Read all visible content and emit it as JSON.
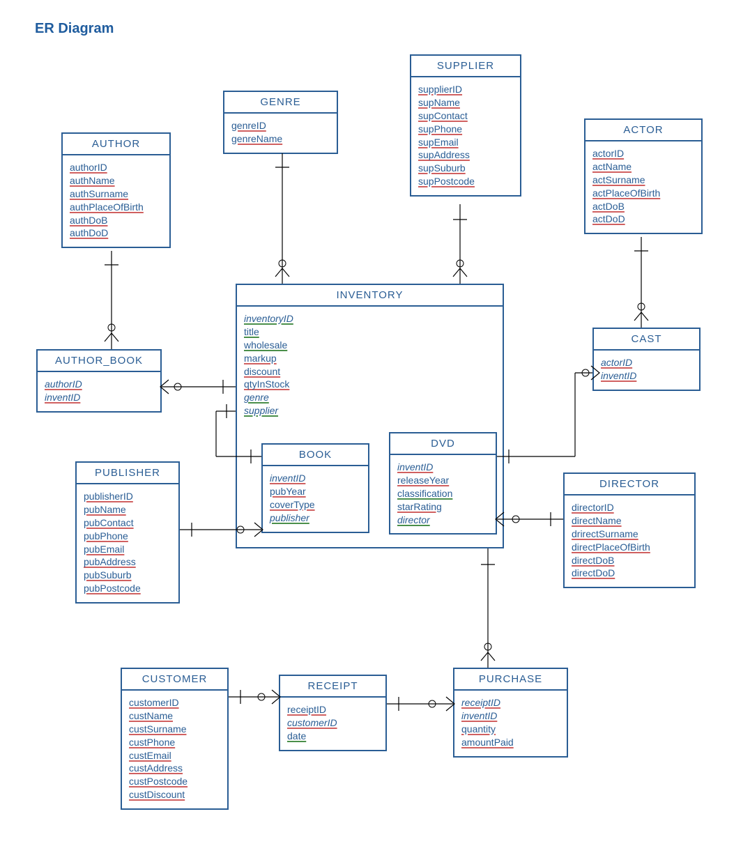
{
  "page_title": "ER Diagram",
  "entities": {
    "author": {
      "name": "AUTHOR",
      "attrs": [
        "authorID",
        "authName",
        "authSurname",
        "authPlaceOfBirth",
        "authDoB",
        "authDoD"
      ]
    },
    "genre": {
      "name": "GENRE",
      "attrs": [
        "genreID",
        "genreName"
      ]
    },
    "supplier": {
      "name": "SUPPLIER",
      "attrs": [
        "supplierID",
        "supName",
        "supContact",
        "supPhone",
        "supEmail",
        "supAddress",
        "supSuburb",
        "supPostcode"
      ]
    },
    "actor": {
      "name": "ACTOR",
      "attrs": [
        "actorID",
        "actName",
        "actSurname",
        "actPlaceOfBirth",
        "actDoB",
        "actDoD"
      ]
    },
    "author_book": {
      "name": "AUTHOR_BOOK",
      "attrs": [
        "authorID",
        "inventID"
      ]
    },
    "inventory": {
      "name": "INVENTORY",
      "attrs": [
        "inventoryID",
        "title",
        "wholesale",
        "markup",
        "discount",
        "qtyInStock",
        "genre",
        "supplier"
      ]
    },
    "cast": {
      "name": "CAST",
      "attrs": [
        "actorID",
        "inventID"
      ]
    },
    "publisher": {
      "name": "PUBLISHER",
      "attrs": [
        "publisherID",
        "pubName",
        "pubContact",
        "pubPhone",
        "pubEmail",
        "pubAddress",
        "pubSuburb",
        "pubPostcode"
      ]
    },
    "book": {
      "name": "BOOK",
      "attrs": [
        "inventID",
        "pubYear",
        "coverType",
        "publisher"
      ]
    },
    "dvd": {
      "name": "DVD",
      "attrs": [
        "inventID",
        "releaseYear",
        "classification",
        "starRating",
        "director"
      ]
    },
    "director": {
      "name": "DIRECTOR",
      "attrs": [
        "directorID",
        "directName",
        "drirectSurname",
        "directPlaceOfBirth",
        "directDoB",
        "directDoD"
      ]
    },
    "customer": {
      "name": "CUSTOMER",
      "attrs": [
        "customerID",
        "custName",
        "custSurname",
        "custPhone",
        "custEmail",
        "custAddress",
        "custPostcode",
        "custDiscount"
      ]
    },
    "receipt": {
      "name": "RECEIPT",
      "attrs": [
        "receiptID",
        "customerID",
        "date"
      ]
    },
    "purchase": {
      "name": "PURCHASE",
      "attrs": [
        "receiptID",
        "inventID",
        "quantity",
        "amountPaid"
      ]
    }
  },
  "chart_data": {
    "type": "er-diagram",
    "entities": [
      {
        "name": "AUTHOR",
        "pk": [
          "authorID"
        ],
        "attrs": [
          "authorID",
          "authName",
          "authSurname",
          "authPlaceOfBirth",
          "authDoB",
          "authDoD"
        ]
      },
      {
        "name": "GENRE",
        "pk": [
          "genreID"
        ],
        "attrs": [
          "genreID",
          "genreName"
        ]
      },
      {
        "name": "SUPPLIER",
        "pk": [
          "supplierID"
        ],
        "attrs": [
          "supplierID",
          "supName",
          "supContact",
          "supPhone",
          "supEmail",
          "supAddress",
          "supSuburb",
          "supPostcode"
        ]
      },
      {
        "name": "ACTOR",
        "pk": [
          "actorID"
        ],
        "attrs": [
          "actorID",
          "actName",
          "actSurname",
          "actPlaceOfBirth",
          "actDoB",
          "actDoD"
        ]
      },
      {
        "name": "AUTHOR_BOOK",
        "pk": [
          "authorID",
          "inventID"
        ],
        "attrs": [
          "authorID",
          "inventID"
        ]
      },
      {
        "name": "INVENTORY",
        "pk": [
          "inventoryID"
        ],
        "attrs": [
          "inventoryID",
          "title",
          "wholesale",
          "markup",
          "discount",
          "qtyInStock",
          "genre",
          "supplier"
        ]
      },
      {
        "name": "CAST",
        "pk": [
          "actorID",
          "inventID"
        ],
        "attrs": [
          "actorID",
          "inventID"
        ]
      },
      {
        "name": "PUBLISHER",
        "pk": [
          "publisherID"
        ],
        "attrs": [
          "publisherID",
          "pubName",
          "pubContact",
          "pubPhone",
          "pubEmail",
          "pubAddress",
          "pubSuburb",
          "pubPostcode"
        ]
      },
      {
        "name": "BOOK",
        "pk": [
          "inventID"
        ],
        "attrs": [
          "inventID",
          "pubYear",
          "coverType",
          "publisher"
        ]
      },
      {
        "name": "DVD",
        "pk": [
          "inventID"
        ],
        "attrs": [
          "inventID",
          "releaseYear",
          "classification",
          "starRating",
          "director"
        ]
      },
      {
        "name": "DIRECTOR",
        "pk": [
          "directorID"
        ],
        "attrs": [
          "directorID",
          "directName",
          "drirectSurname",
          "directPlaceOfBirth",
          "directDoB",
          "directDoD"
        ]
      },
      {
        "name": "CUSTOMER",
        "pk": [
          "customerID"
        ],
        "attrs": [
          "customerID",
          "custName",
          "custSurname",
          "custPhone",
          "custEmail",
          "custAddress",
          "custPostcode",
          "custDiscount"
        ]
      },
      {
        "name": "RECEIPT",
        "pk": [
          "receiptID"
        ],
        "attrs": [
          "receiptID",
          "customerID",
          "date"
        ]
      },
      {
        "name": "PURCHASE",
        "pk": [
          "receiptID",
          "inventID"
        ],
        "attrs": [
          "receiptID",
          "inventID",
          "quantity",
          "amountPaid"
        ]
      }
    ],
    "relationships": [
      {
        "from": "AUTHOR",
        "to": "AUTHOR_BOOK",
        "cardinality": "1..*"
      },
      {
        "from": "AUTHOR_BOOK",
        "to": "INVENTORY",
        "cardinality": "0..*-1"
      },
      {
        "from": "GENRE",
        "to": "INVENTORY",
        "cardinality": "1-*"
      },
      {
        "from": "SUPPLIER",
        "to": "INVENTORY",
        "cardinality": "1-*"
      },
      {
        "from": "ACTOR",
        "to": "CAST",
        "cardinality": "1-*"
      },
      {
        "from": "CAST",
        "to": "DVD",
        "cardinality": "0..*-1"
      },
      {
        "from": "INVENTORY",
        "to": "BOOK",
        "cardinality": "1-1"
      },
      {
        "from": "INVENTORY",
        "to": "DVD",
        "cardinality": "1-1"
      },
      {
        "from": "PUBLISHER",
        "to": "BOOK",
        "cardinality": "1-0..*"
      },
      {
        "from": "DIRECTOR",
        "to": "DVD",
        "cardinality": "1-0..*"
      },
      {
        "from": "DVD",
        "to": "PURCHASE",
        "cardinality": "1-*"
      },
      {
        "from": "CUSTOMER",
        "to": "RECEIPT",
        "cardinality": "1-0..*"
      },
      {
        "from": "RECEIPT",
        "to": "PURCHASE",
        "cardinality": "1-0..*"
      }
    ]
  }
}
